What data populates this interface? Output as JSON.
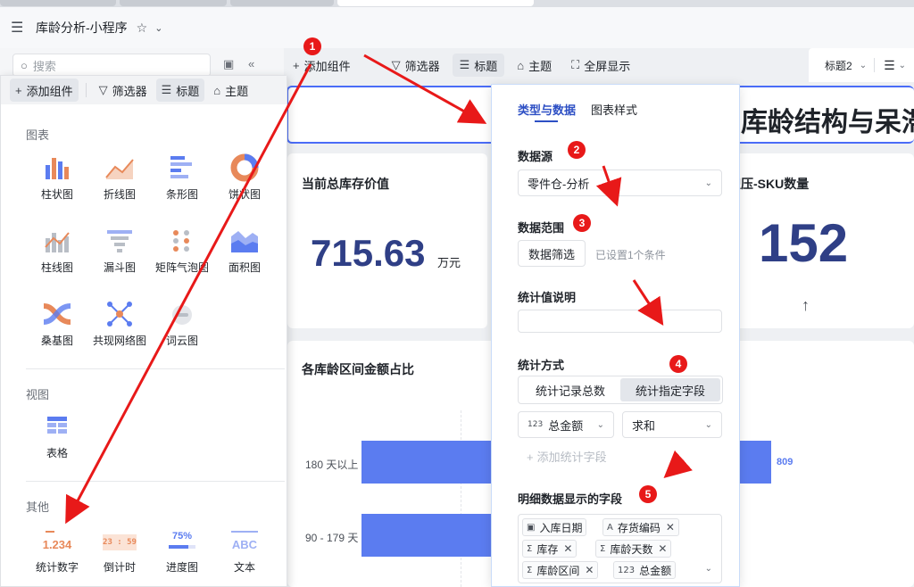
{
  "app": {
    "title": "库龄分析-小程序",
    "search_placeholder": "搜索"
  },
  "toolbar": {
    "add_component": "添加组件",
    "filter": "筛选器",
    "title": "标题",
    "theme": "主题",
    "fullscreen": "全屏显示",
    "title_level": "标题2"
  },
  "dashboard": {
    "banner_title": "库龄结构与呆滞",
    "kpi1": {
      "title": "当前总库存价值",
      "value": "715.63",
      "unit": "万元"
    },
    "kpi2": {
      "title": "呆滞积压-SKU数量",
      "title_visible": "积压-SKU数量",
      "value": "152",
      "trend_icon": "arrow-up-icon"
    },
    "bar_card": {
      "title": "各库龄区间金额占比"
    }
  },
  "chart_data": {
    "type": "bar",
    "orientation": "horizontal",
    "title": "各库龄区间金额占比",
    "categories": [
      "180 天以上",
      "90 - 179 天"
    ],
    "values": [
      809,
      null
    ],
    "note_values": "second bar value hidden behind panel"
  },
  "gallery": {
    "sections": {
      "charts": "图表",
      "views": "视图",
      "others": "其他"
    },
    "charts": [
      "柱状图",
      "折线图",
      "条形图",
      "饼状图",
      "柱线图",
      "漏斗图",
      "矩阵气泡图",
      "面积图",
      "桑基图",
      "共现网络图",
      "词云图"
    ],
    "views": [
      "表格"
    ],
    "others": [
      "统计数字",
      "倒计时",
      "进度图",
      "文本"
    ],
    "others_icon_text": [
      "1.234",
      "23 : 59",
      "75%",
      "ABC"
    ]
  },
  "config_panel": {
    "tabs": [
      "类型与数据",
      "图表样式"
    ],
    "data_source_label": "数据源",
    "data_source_value": "零件仓-分析",
    "data_range_label": "数据范围",
    "data_filter_button": "数据筛选",
    "data_filter_hint": "已设置1个条件",
    "stat_desc_label": "统计值说明",
    "stat_method_label": "统计方式",
    "stat_options": [
      "统计记录总数",
      "统计指定字段"
    ],
    "stat_field": "总金额",
    "stat_agg": "求和",
    "add_stat_field": "添加统计字段",
    "detail_fields_label": "明细数据显示的字段",
    "detail_fields": [
      {
        "name": "入库日期",
        "icon": "calendar-icon",
        "removable": false
      },
      {
        "name": "存货编码",
        "icon": "text-field-icon",
        "removable": true
      },
      {
        "name": "库存",
        "icon": "sum-icon",
        "removable": true
      },
      {
        "name": "库龄天数",
        "icon": "sum-icon",
        "removable": true
      },
      {
        "name": "库龄区间",
        "icon": "sum-icon",
        "removable": true
      },
      {
        "name": "总金额",
        "icon": "number-field-icon",
        "removable": false
      }
    ]
  },
  "steps": [
    "1",
    "2",
    "3",
    "4",
    "5"
  ],
  "colors": {
    "accent": "#2d4fc4",
    "bar": "#5b7cf0",
    "kpi": "#2f3f86",
    "step": "#e81919"
  }
}
